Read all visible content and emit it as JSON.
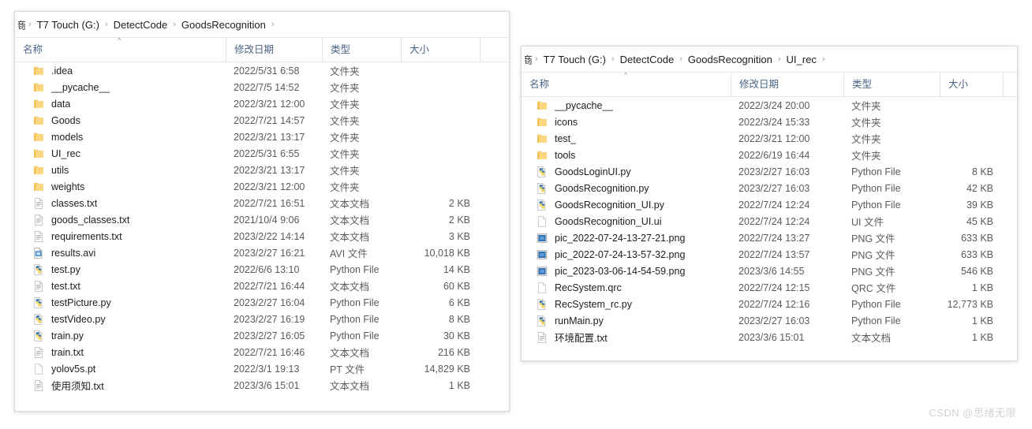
{
  "watermark": "CSDN @思绪无限",
  "columns": {
    "name": "名称",
    "date": "修改日期",
    "type": "类型",
    "size": "大小",
    "sort_caret": "^"
  },
  "separator": "›",
  "left_window": {
    "breadcrumb_clipped": "商",
    "breadcrumb": [
      "T7 Touch (G:)",
      "DetectCode",
      "GoodsRecognition"
    ],
    "rows": [
      {
        "icon": "folder-icon",
        "name": ".idea",
        "date": "2022/5/31 6:58",
        "type": "文件夹",
        "size": ""
      },
      {
        "icon": "folder-icon",
        "name": "__pycache__",
        "date": "2022/7/5 14:52",
        "type": "文件夹",
        "size": ""
      },
      {
        "icon": "folder-icon",
        "name": "data",
        "date": "2022/3/21 12:00",
        "type": "文件夹",
        "size": ""
      },
      {
        "icon": "folder-icon",
        "name": "Goods",
        "date": "2022/7/21 14:57",
        "type": "文件夹",
        "size": ""
      },
      {
        "icon": "folder-icon",
        "name": "models",
        "date": "2022/3/21 13:17",
        "type": "文件夹",
        "size": ""
      },
      {
        "icon": "folder-icon",
        "name": "UI_rec",
        "date": "2022/5/31 6:55",
        "type": "文件夹",
        "size": ""
      },
      {
        "icon": "folder-icon",
        "name": "utils",
        "date": "2022/3/21 13:17",
        "type": "文件夹",
        "size": ""
      },
      {
        "icon": "folder-icon",
        "name": "weights",
        "date": "2022/3/21 12:00",
        "type": "文件夹",
        "size": ""
      },
      {
        "icon": "text-file-icon",
        "name": "classes.txt",
        "date": "2022/7/21 16:51",
        "type": "文本文档",
        "size": "2 KB"
      },
      {
        "icon": "text-file-icon",
        "name": "goods_classes.txt",
        "date": "2021/10/4 9:06",
        "type": "文本文档",
        "size": "2 KB"
      },
      {
        "icon": "text-file-icon",
        "name": "requirements.txt",
        "date": "2023/2/22 14:14",
        "type": "文本文档",
        "size": "3 KB"
      },
      {
        "icon": "video-file-icon",
        "name": "results.avi",
        "date": "2023/2/27 16:21",
        "type": "AVI 文件",
        "size": "10,018 KB"
      },
      {
        "icon": "python-file-icon",
        "name": "test.py",
        "date": "2022/6/6 13:10",
        "type": "Python File",
        "size": "14 KB"
      },
      {
        "icon": "text-file-icon",
        "name": "test.txt",
        "date": "2022/7/21 16:44",
        "type": "文本文档",
        "size": "60 KB"
      },
      {
        "icon": "python-file-icon",
        "name": "testPicture.py",
        "date": "2023/2/27 16:04",
        "type": "Python File",
        "size": "6 KB"
      },
      {
        "icon": "python-file-icon",
        "name": "testVideo.py",
        "date": "2023/2/27 16:19",
        "type": "Python File",
        "size": "8 KB"
      },
      {
        "icon": "python-file-icon",
        "name": "train.py",
        "date": "2023/2/27 16:05",
        "type": "Python File",
        "size": "30 KB"
      },
      {
        "icon": "text-file-icon",
        "name": "train.txt",
        "date": "2022/7/21 16:46",
        "type": "文本文档",
        "size": "216 KB"
      },
      {
        "icon": "blank-file-icon",
        "name": "yolov5s.pt",
        "date": "2022/3/1 19:13",
        "type": "PT 文件",
        "size": "14,829 KB"
      },
      {
        "icon": "text-file-icon",
        "name": "使用须知.txt",
        "date": "2023/3/6 15:01",
        "type": "文本文档",
        "size": "1 KB"
      }
    ]
  },
  "right_window": {
    "breadcrumb_clipped": "商",
    "breadcrumb": [
      "T7 Touch (G:)",
      "DetectCode",
      "GoodsRecognition",
      "UI_rec"
    ],
    "rows": [
      {
        "icon": "folder-icon",
        "name": "__pycache__",
        "date": "2022/3/24 20:00",
        "type": "文件夹",
        "size": ""
      },
      {
        "icon": "folder-icon",
        "name": "icons",
        "date": "2022/3/24 15:33",
        "type": "文件夹",
        "size": ""
      },
      {
        "icon": "folder-icon",
        "name": "test_",
        "date": "2022/3/21 12:00",
        "type": "文件夹",
        "size": ""
      },
      {
        "icon": "folder-icon",
        "name": "tools",
        "date": "2022/6/19 16:44",
        "type": "文件夹",
        "size": ""
      },
      {
        "icon": "python-file-icon",
        "name": "GoodsLoginUI.py",
        "date": "2023/2/27 16:03",
        "type": "Python File",
        "size": "8 KB"
      },
      {
        "icon": "python-file-icon",
        "name": "GoodsRecognition.py",
        "date": "2023/2/27 16:03",
        "type": "Python File",
        "size": "42 KB"
      },
      {
        "icon": "python-file-icon",
        "name": "GoodsRecognition_UI.py",
        "date": "2022/7/24 12:24",
        "type": "Python File",
        "size": "39 KB"
      },
      {
        "icon": "blank-file-icon",
        "name": "GoodsRecognition_UI.ui",
        "date": "2022/7/24 12:24",
        "type": "UI 文件",
        "size": "45 KB"
      },
      {
        "icon": "image-file-icon",
        "name": "pic_2022-07-24-13-27-21.png",
        "date": "2022/7/24 13:27",
        "type": "PNG 文件",
        "size": "633 KB"
      },
      {
        "icon": "image-file-icon",
        "name": "pic_2022-07-24-13-57-32.png",
        "date": "2022/7/24 13:57",
        "type": "PNG 文件",
        "size": "633 KB"
      },
      {
        "icon": "image-file-icon",
        "name": "pic_2023-03-06-14-54-59.png",
        "date": "2023/3/6 14:55",
        "type": "PNG 文件",
        "size": "546 KB"
      },
      {
        "icon": "blank-file-icon",
        "name": "RecSystem.qrc",
        "date": "2022/7/24 12:15",
        "type": "QRC 文件",
        "size": "1 KB"
      },
      {
        "icon": "python-file-icon",
        "name": "RecSystem_rc.py",
        "date": "2022/7/24 12:16",
        "type": "Python File",
        "size": "12,773 KB"
      },
      {
        "icon": "python-file-icon",
        "name": "runMain.py",
        "date": "2023/2/27 16:03",
        "type": "Python File",
        "size": "1 KB"
      },
      {
        "icon": "text-file-icon",
        "name": "环境配置.txt",
        "date": "2023/3/6 15:01",
        "type": "文本文档",
        "size": "1 KB"
      }
    ]
  },
  "colors": {
    "folder": "#fcd77f",
    "folder_shade": "#f0bf55",
    "header_text": "#4a6484",
    "python_blue": "#3c78a8",
    "python_yellow": "#f5d55c",
    "png_blue": "#2a6fb5",
    "avi_blue": "#3b87c9"
  }
}
